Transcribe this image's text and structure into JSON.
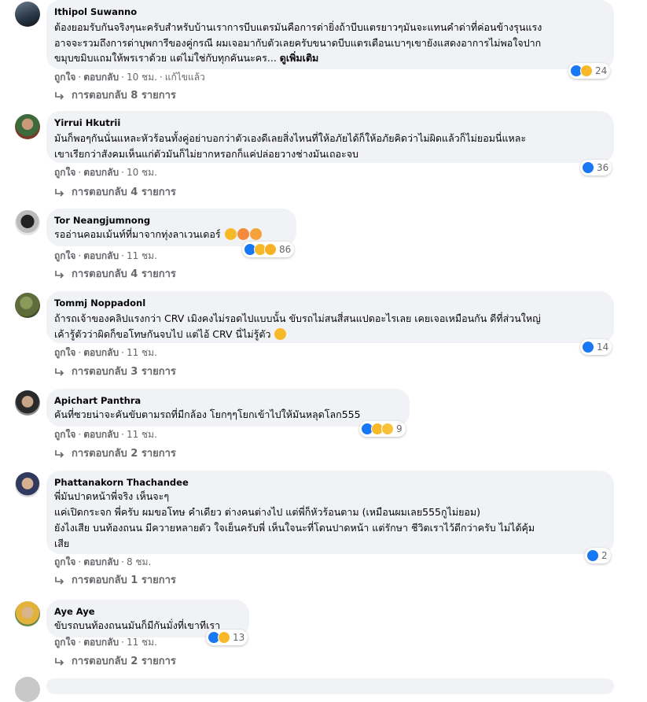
{
  "labels": {
    "like": "ถูกใจ",
    "reply": "ตอบกลับ",
    "sep": "·"
  },
  "comments": [
    {
      "author": "Ithipol Suwanno",
      "lines": [
        "ต้องยอมรับกันจริงๆนะครับสำหรับบ้านเราการบีบแตรมันคือการด่ายิ่งถ้าบีบแตรยาวๆมันจะแทนคำด่าที่ค่อนข้างรุนแรง",
        "อาจจะรวมถึงการด่าบุพการีของคู่กรณี ผมเจอมากับตัวเลยครับขนาดบีบแตรเตือนเบาๆเขายังแสดงอาการไม่พอใจปาก",
        "ขมุบขมิบแถมให้พรเราด้วย แต่ไม่ใช่กับทุกคันนะคร..."
      ],
      "see_more": "ดูเพิ่มเติม",
      "time": "10 ชม.",
      "edited": "แก้ไขแล้ว",
      "reaction_count": "24",
      "replies": "การตอบกลับ 8 รายการ"
    },
    {
      "author": "Yirrui Hkutrii",
      "lines": [
        "มันก็พอๆกันนั่นแหละหัวร้อนทั้งคู่อย่าบอกว่าตัวเองดีเลยสิ่งไหนที่ให้อภัยได้ก็ให้อภัยคิดว่าไม่ผิดแล้วก็ไม่ยอมนี่แหละ",
        "เขาเรียกว่าสังคมเห็นแก่ตัวมันก็ไม่ยากหรอกก็แค่ปล่อยวางช่างมันเถอะจบ"
      ],
      "time": "10 ชม.",
      "reaction_count": "36",
      "replies": "การตอบกลับ 4 รายการ"
    },
    {
      "author": "Tor Neangjumnong",
      "lines": [
        "รออ่านคอมเม้นท์ที่มาจากทุ่งลาเวนเดอร์"
      ],
      "time": "11 ชม.",
      "reaction_count": "86",
      "replies": "การตอบกลับ 4 รายการ"
    },
    {
      "author": "Tommj Noppadonl",
      "lines": [
        "ถ้ารถเจ้าของคลิปแรงกว่า CRV เมิงคงไม่รอดไปแบบนั้น ขับรถไม่สนสี่สนแปดอะไรเลย เคยเจอเหมือนกัน ดีที่ส่วนใหญ่",
        "เค้ารู้ตัวว่าผิดก็ขอโทษกันจบไป แต่ไอ้ CRV นี่ไม่รู้ตัว"
      ],
      "time": "11 ชม.",
      "reaction_count": "14",
      "replies": "การตอบกลับ 3 รายการ"
    },
    {
      "author": "Apichart Panthra",
      "lines": [
        "คันที่ซวยน่าจะคันขับตามรถที่มีกล้อง โยกๆๆโยกเข้าไปให้มันหลุดโลก555"
      ],
      "time": "11 ชม.",
      "reaction_count": "9",
      "replies": "การตอบกลับ 2 รายการ"
    },
    {
      "author": "Phattanakorn Thachandee",
      "lines": [
        "พี่มันปาดหน้าพี่จริง เห็นจะๆ",
        "แค่เปิดกระจก พี่ครับ ผมขอโทษ คำเดียว ต่างคนต่างไป แต่พี่ก็หัวร้อนตาม (เหมือนผมเลย555กูไม่ยอม)",
        "ยังไงเสีย บนท้องถนน มีควายหลายตัว ใจเย็นครับพี่ เห็นใจนะที่โดนปาดหน้า แต่รักษา ชีวิตเราไว้ดีกว่าครับ ไม่ได้คุ้ม",
        "เสีย"
      ],
      "time": "8 ชม.",
      "reaction_count": "2",
      "replies": "การตอบกลับ 1 รายการ"
    },
    {
      "author": "Aye Aye",
      "lines": [
        "ขับรถบนท้องถนนมันก็มีกันมั่งที่เขาทีเรา"
      ],
      "time": "11 ชม.",
      "reaction_count": "13",
      "replies": "การตอบกลับ 2 รายการ"
    }
  ],
  "colors": {
    "bubble": "#f0f2f5",
    "like_blue": "#1877f2",
    "haha_yellow": "#f7b928",
    "love_red": "#f33e58",
    "muted_text": "#65676b"
  }
}
